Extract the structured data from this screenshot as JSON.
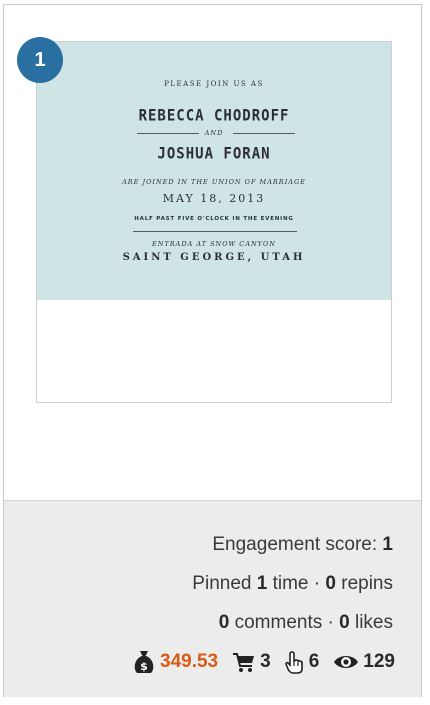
{
  "card": {
    "rank": "1",
    "invitation": {
      "please": "PLEASE JOIN US AS",
      "name1": "REBECCA CHODROFF",
      "and": "AND",
      "name2": "JOSHUA FORAN",
      "joined": "ARE JOINED IN THE UNION OF MARRIAGE",
      "date": "MAY 18, 2013",
      "time": "HALF PAST FIVE O'CLOCK IN THE EVENING",
      "venue": "ENTRADA AT SNOW CANYON",
      "city": "SAINT GEORGE, UTAH",
      "background_color": "#cfe5e5"
    }
  },
  "stats": {
    "engagement_label": "Engagement score:",
    "engagement_value": "1",
    "pinned_label": "Pinned",
    "pinned_value": "1",
    "time_label": "time ·",
    "repins_value": "0",
    "repins_label": "repins",
    "comments_value": "0",
    "comments_label": "comments ·",
    "likes_value": "0",
    "likes_label": "likes",
    "price": "349.53",
    "cart": "3",
    "clicks": "6",
    "views": "129",
    "price_color": "#d85a14"
  }
}
